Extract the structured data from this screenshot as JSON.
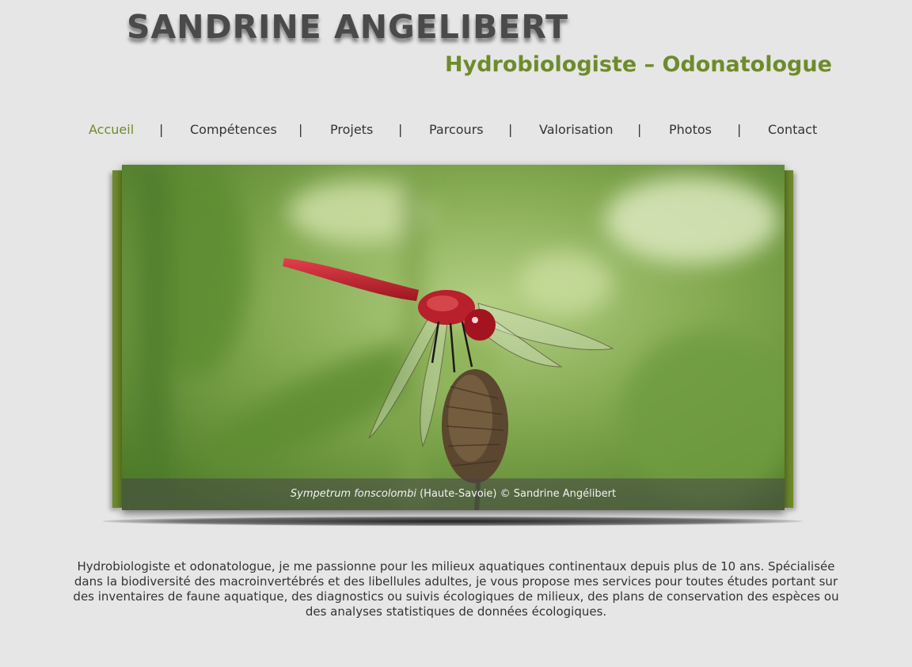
{
  "header": {
    "title": "SANDRINE ANGELIBERT",
    "subtitle": "Hydrobiologiste – Odonatologue"
  },
  "nav": {
    "items": [
      {
        "label": "Accueil",
        "active": true
      },
      {
        "label": "Compétences",
        "active": false
      },
      {
        "label": "Projets",
        "active": false
      },
      {
        "label": "Parcours",
        "active": false
      },
      {
        "label": "Valorisation",
        "active": false
      },
      {
        "label": "Photos",
        "active": false
      },
      {
        "label": "Contact",
        "active": false
      }
    ],
    "separator": "|"
  },
  "slider": {
    "caption_species": "Sympetrum fonscolombi",
    "caption_rest": " (Haute-Savoie) © Sandrine Angélibert"
  },
  "intro": {
    "text": "Hydrobiologiste et odonatologue, je me passionne pour les milieux aquatiques continentaux depuis plus de 10 ans. Spécialisée dans la biodiversité des macroinvertébrés et des libellules adultes, je vous propose mes services pour toutes études portant sur des inventaires de faune aquatique, des diagnostics ou suivis écologiques de milieux, des plans de conservation des espèces ou des analyses statistiques de données écologiques."
  },
  "colors": {
    "accent": "#6e8b2b",
    "background": "#e6e6e6",
    "text": "#333333",
    "dragonfly": "#c0202a"
  },
  "icons": [
    "dragonfly-photo"
  ]
}
